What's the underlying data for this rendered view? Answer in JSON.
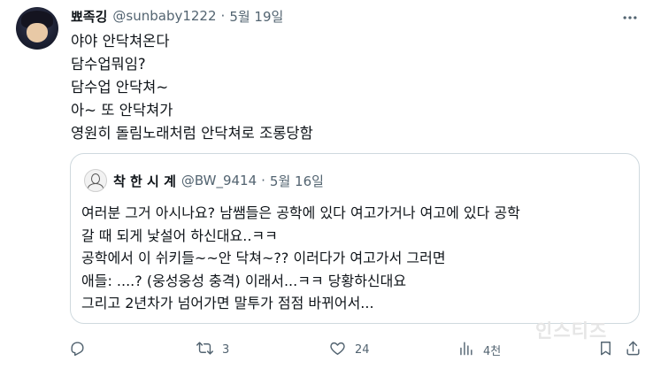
{
  "tweet": {
    "author_name": "뾰족깅",
    "handle": "@sunbaby1222",
    "separator": "·",
    "date": "5월 19일",
    "more_icon": "ellipsis-icon",
    "lines": [
      "야야 안닥쳐온다",
      "담수업뭐임?",
      "담수업 안닥쳐~",
      "아~ 또 안닥쳐가",
      "영원히 돌림노래처럼 안닥쳐로 조롱당함"
    ]
  },
  "quoted": {
    "author_name": "착 한 시 계",
    "handle": "@BW_9414",
    "separator": "·",
    "date": "5월 16일",
    "lines": [
      "여러분 그거 아시나요? 남쌤들은 공학에 있다 여고가거나 여고에 있다 공학",
      "갈 때 되게 낯설어 하신대요..ㅋㅋ",
      "공학에서 이 쉬키들~~안 닥쳐~?? 이러다가 여고가서 그러면",
      "애들: ....? (웅성웅성 충격) 이래서...ㅋㅋ 당황하신대요",
      "그리고 2년차가 넘어가면 말투가 점점 바뀌어서..."
    ]
  },
  "actions": {
    "reply": {
      "icon": "reply-icon",
      "count": ""
    },
    "retweet": {
      "icon": "retweet-icon",
      "count": "3"
    },
    "like": {
      "icon": "heart-icon",
      "count": "24"
    },
    "views": {
      "icon": "views-icon",
      "count": "4천"
    },
    "bookmark": {
      "icon": "bookmark-icon",
      "count": ""
    },
    "share": {
      "icon": "share-icon",
      "count": ""
    }
  },
  "watermark": "인스티즈",
  "colors": {
    "text": "#0f1419",
    "secondary": "#536471",
    "border": "#cfd9de"
  }
}
